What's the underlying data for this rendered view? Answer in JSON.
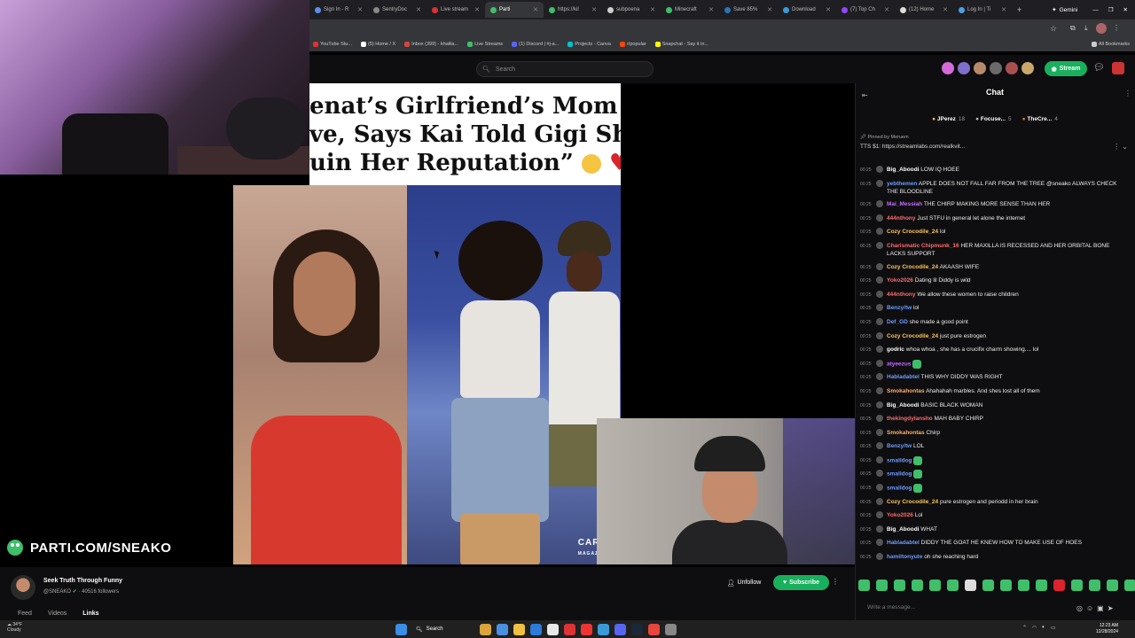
{
  "browser": {
    "tabs": [
      {
        "label": "Sign In - R",
        "color": "#5a8ef0"
      },
      {
        "label": "SentryDoc",
        "color": "#888888"
      },
      {
        "label": "Live stream",
        "color": "#e03030"
      },
      {
        "label": "Parti",
        "color": "#3fbf6a",
        "active": true
      },
      {
        "label": "https://kil",
        "color": "#3fbf6a"
      },
      {
        "label": "subpoena",
        "color": "#cccccc"
      },
      {
        "label": "Minecraft",
        "color": "#3fbf6a"
      },
      {
        "label": "Save 85%",
        "color": "#2a75bb"
      },
      {
        "label": "Download",
        "color": "#3a9ad9"
      },
      {
        "label": "(7) Top Ch",
        "color": "#9146ff"
      },
      {
        "label": "(12) Home",
        "color": "#dddddd"
      },
      {
        "label": "Log In | Ti",
        "color": "#4aa0e0"
      }
    ],
    "new_tab": "+",
    "gemini": "Gemini",
    "bookmarks": [
      "YouTube Stu...",
      "(5) Home / X",
      "Inbox (399) - khalila...",
      "Live Streams",
      "(1) Discord | #j-a...",
      "Projects - Canva",
      "r/popular",
      "Snapchat - Say it in..."
    ],
    "all_bookmarks": "All Bookmarks"
  },
  "site": {
    "search_placeholder": "Search",
    "stream_label": "Stream"
  },
  "stream": {
    "headline_lines": [
      "enat’s Girlfriend’s Mom Cries",
      "ve, Says Kai Told Gigi She’d",
      "uin Her Reputation” "
    ],
    "photo_caption": "CARAM",
    "photo_caption_sub": "MAGAZ",
    "logo_text": "PARTI.COM/SNEAKO"
  },
  "channel": {
    "title": "Seek Truth Through Funny",
    "handle": "@SNEAKO",
    "followers": "· 40516  followers",
    "unfollow": "Unfollow",
    "subscribe": "Subscribe",
    "tabs": [
      "Feed",
      "Videos",
      "Links"
    ],
    "active_tab": "Links"
  },
  "chat": {
    "title": "Chat",
    "leaders": [
      {
        "name": "JPerez",
        "count": "18"
      },
      {
        "name": "Focuse...",
        "count": "5"
      },
      {
        "name": "TheCre...",
        "count": "4"
      }
    ],
    "pinned_by": "Pinned by",
    "pinned_user": "Meruem",
    "pinned_msg": "TTS $1: https://streamlabs.com/realkvit...",
    "messages": [
      {
        "time": "00:25",
        "user": "Big_Aboodi",
        "color": "#ffffff",
        "text": "LOW IQ HOEE"
      },
      {
        "time": "00:25",
        "user": "yebthemen",
        "color": "#6f9cff",
        "text": "APPLE DOES NOT FALL FAR FROM THE TREE @sneako ALWAYS CHECK THE BLOODLINE"
      },
      {
        "time": "00:25",
        "user": "Mai_Messiah",
        "color": "#c86cff",
        "text": "THE CHIRP MAKING MORE SENSE THAN HER"
      },
      {
        "time": "00:25",
        "user": "444nthony",
        "color": "#ff6b6b",
        "text": "Just STFU in general let alone the internet"
      },
      {
        "time": "00:25",
        "user": "Cozy Crocodile_24",
        "color": "#ffc857",
        "text": "lol"
      },
      {
        "time": "00:25",
        "user": "Charismatic Chipmunk_16",
        "color": "#ff6b6b",
        "text": "HER MAXILLA IS RECESSED AND HER ORBITAL BONE LACKS SUPPORT"
      },
      {
        "time": "00:25",
        "user": "Cozy Crocodile_24",
        "color": "#ffc857",
        "text": "AKAASH WIFE"
      },
      {
        "time": "00:25",
        "user": "Yoko2026",
        "color": "#ff6b6b",
        "text": "Dating lil Diddy is wild"
      },
      {
        "time": "00:25",
        "user": "444nthony",
        "color": "#ff6b6b",
        "text": "We allow these women to raise children"
      },
      {
        "time": "00:25",
        "user": "Benzy/tw",
        "color": "#6f9cff",
        "text": "lol"
      },
      {
        "time": "00:25",
        "user": "Def_GD",
        "color": "#6f9cff",
        "text": "she made a good point"
      },
      {
        "time": "00:25",
        "user": "Cozy Crocodile_24",
        "color": "#ffc857",
        "text": "just pure estrogen"
      },
      {
        "time": "00:25",
        "user": "godric",
        "color": "#ffffff",
        "text": "whoa whoa , she has a crucifix charm showing.... lol"
      },
      {
        "time": "00:25",
        "user": "atyeezus",
        "color": "#c86cff",
        "text": "",
        "emote": true
      },
      {
        "time": "00:25",
        "user": "Habladabtel",
        "color": "#6f9cff",
        "text": "THIS WHY DIDDY WAS RIGHT"
      },
      {
        "time": "00:25",
        "user": "Smokahontas",
        "color": "#ffb06b",
        "text": "Ahahahah marbles. And shes lost all of them"
      },
      {
        "time": "00:25",
        "user": "Big_Aboodi",
        "color": "#ffffff",
        "text": "BASIC BLACK WOMAN"
      },
      {
        "time": "00:25",
        "user": "thekingdylansho",
        "color": "#ff6b6b",
        "text": "MAH BABY CHIRP"
      },
      {
        "time": "00:25",
        "user": "Smokahontas",
        "color": "#ffb06b",
        "text": "Chirp"
      },
      {
        "time": "00:25",
        "user": "Benzy/tw",
        "color": "#6f9cff",
        "text": "LOL"
      },
      {
        "time": "00:25",
        "user": "smalldog",
        "color": "#6f9cff",
        "text": "",
        "emote": true
      },
      {
        "time": "00:25",
        "user": "smalldog",
        "color": "#6f9cff",
        "text": "",
        "emote": true
      },
      {
        "time": "00:25",
        "user": "smalldog",
        "color": "#6f9cff",
        "text": "",
        "emote": true
      },
      {
        "time": "00:25",
        "user": "Cozy Crocodile_24",
        "color": "#ffc857",
        "text": "pure estrogen and periodd in her brain"
      },
      {
        "time": "00:25",
        "user": "Yoko2026",
        "color": "#ff6b6b",
        "text": "Lol"
      },
      {
        "time": "00:25",
        "user": "Big_Aboodi",
        "color": "#ffffff",
        "text": "WHAT"
      },
      {
        "time": "00:25",
        "user": "Habladabtel",
        "color": "#6f9cff",
        "text": "DIDDY THE GOAT HE KNEW HOW TO MAKE USE OF HOES"
      },
      {
        "time": "00:25",
        "user": "hamiltonyute",
        "color": "#6f9cff",
        "text": "oh she reaching hard"
      }
    ],
    "input_placeholder": "Write a message..."
  },
  "taskbar": {
    "weather_temp": "34°F",
    "weather_desc": "Cloudy",
    "search_label": "Search",
    "time": "12:23 AM",
    "date": "12/28/2024"
  }
}
